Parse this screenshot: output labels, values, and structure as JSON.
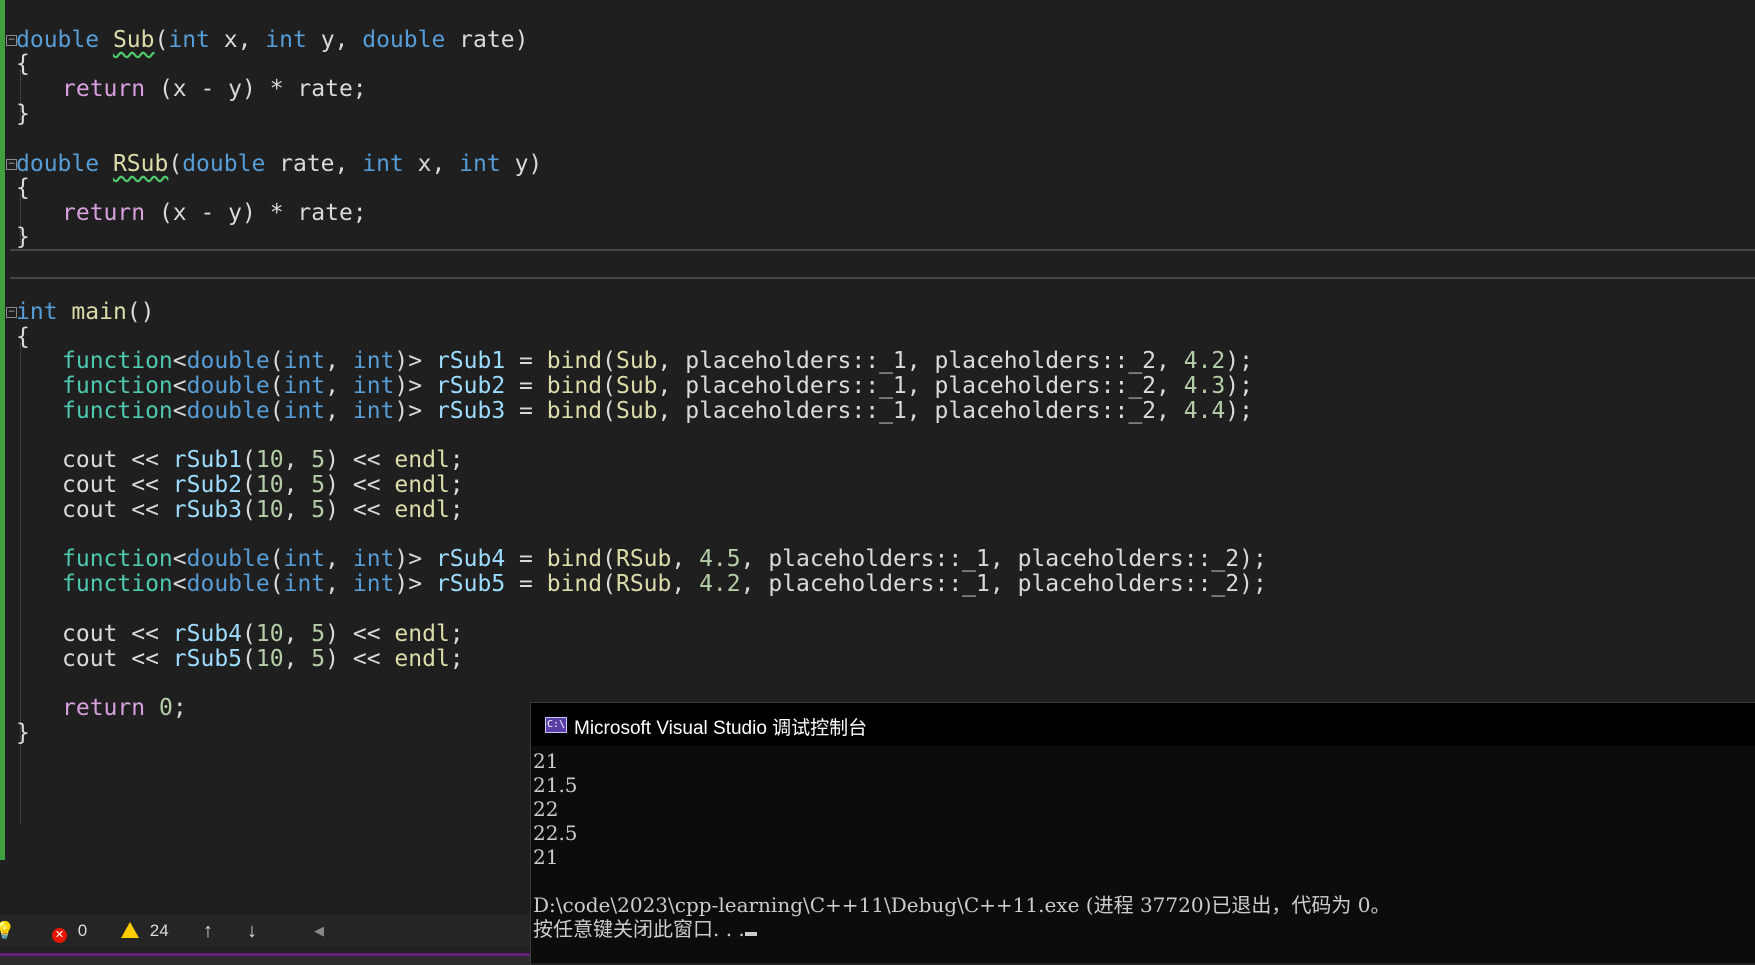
{
  "code": {
    "sub_sig": {
      "ret": "double",
      "name": "Sub",
      "open": "(",
      "t1": "int",
      "p1": " x, ",
      "t2": "int",
      "p2": " y, ",
      "t3": "double",
      "p3": " rate)"
    },
    "brace_open": "{",
    "brace_close": "}",
    "ret_kw": "return",
    "ret_expr": " (x - y) * rate;",
    "rsub_sig": {
      "ret": "double",
      "name": "RSub",
      "open": "(",
      "t1": "double",
      "p1": " rate, ",
      "t2": "int",
      "p2": " x, ",
      "t3": "int",
      "p3": " y)"
    },
    "main_sig": {
      "ret": "int",
      "name": "main",
      "rest": "()"
    },
    "fn_decls": [
      {
        "type": "function",
        "lt": "<",
        "d": "double",
        "op": "(",
        "a": "int",
        "c": ", ",
        "b": "int",
        "gt": ")> ",
        "var": "rSub1",
        "eq": " = ",
        "bind": "bind",
        "open": "(",
        "target": "Sub",
        "mid": ", placeholders::_1, placeholders::_2, ",
        "num": "4.2",
        "end": ");"
      },
      {
        "type": "function",
        "lt": "<",
        "d": "double",
        "op": "(",
        "a": "int",
        "c": ", ",
        "b": "int",
        "gt": ")> ",
        "var": "rSub2",
        "eq": " = ",
        "bind": "bind",
        "open": "(",
        "target": "Sub",
        "mid": ", placeholders::_1, placeholders::_2, ",
        "num": "4.3",
        "end": ");"
      },
      {
        "type": "function",
        "lt": "<",
        "d": "double",
        "op": "(",
        "a": "int",
        "c": ", ",
        "b": "int",
        "gt": ")> ",
        "var": "rSub3",
        "eq": " = ",
        "bind": "bind",
        "open": "(",
        "target": "Sub",
        "mid": ", placeholders::_1, placeholders::_2, ",
        "num": "4.4",
        "end": ");"
      }
    ],
    "cout_lines_1": [
      {
        "cout": "cout",
        "op": " << ",
        "call": "rSub1",
        "open": "(",
        "n1": "10",
        "c": ", ",
        "n2": "5",
        "close": ")",
        "op2": " << ",
        "endl": "endl",
        "end": ";"
      },
      {
        "cout": "cout",
        "op": " << ",
        "call": "rSub2",
        "open": "(",
        "n1": "10",
        "c": ", ",
        "n2": "5",
        "close": ")",
        "op2": " << ",
        "endl": "endl",
        "end": ";"
      },
      {
        "cout": "cout",
        "op": " << ",
        "call": "rSub3",
        "open": "(",
        "n1": "10",
        "c": ", ",
        "n2": "5",
        "close": ")",
        "op2": " << ",
        "endl": "endl",
        "end": ";"
      }
    ],
    "fn_decls_2": [
      {
        "type": "function",
        "lt": "<",
        "d": "double",
        "op": "(",
        "a": "int",
        "c": ", ",
        "b": "int",
        "gt": ")> ",
        "var": "rSub4",
        "eq": " = ",
        "bind": "bind",
        "open": "(",
        "target": "RSub",
        "c2": ", ",
        "num": "4.5",
        "mid": ", placeholders::_1, placeholders::_2);"
      },
      {
        "type": "function",
        "lt": "<",
        "d": "double",
        "op": "(",
        "a": "int",
        "c": ", ",
        "b": "int",
        "gt": ")> ",
        "var": "rSub5",
        "eq": " = ",
        "bind": "bind",
        "open": "(",
        "target": "RSub",
        "c2": ", ",
        "num": "4.2",
        "mid": ", placeholders::_1, placeholders::_2);"
      }
    ],
    "cout_lines_2": [
      {
        "cout": "cout",
        "op": " << ",
        "call": "rSub4",
        "open": "(",
        "n1": "10",
        "c": ", ",
        "n2": "5",
        "close": ")",
        "op2": " << ",
        "endl": "endl",
        "end": ";"
      },
      {
        "cout": "cout",
        "op": " << ",
        "call": "rSub5",
        "open": "(",
        "n1": "10",
        "c": ", ",
        "n2": "5",
        "close": ")",
        "op2": " << ",
        "endl": "endl",
        "end": ";"
      }
    ],
    "main_return": {
      "kw": "return",
      "sp": " ",
      "num": "0",
      "end": ";"
    }
  },
  "statusbar": {
    "errors_icon": "error-icon",
    "errors_count": "0",
    "warnings_icon": "warning-icon",
    "warnings_count": "24",
    "up_arrow": "↑",
    "down_arrow": "↓",
    "scroll_left": "◀"
  },
  "console": {
    "title": "Microsoft Visual Studio 调试控制台",
    "icon_text": "C:\\",
    "output": [
      "21",
      "21.5",
      "22",
      "22.5",
      "21"
    ],
    "exit_message": "D:\\code\\2023\\cpp-learning\\C++11\\Debug\\C++11.exe (进程 37720)已退出，代码为 0。",
    "prompt": "按任意键关闭此窗口. . ."
  },
  "colors": {
    "keyword": "#569cd6",
    "control": "#d8a0df",
    "function": "#dcdcaa",
    "type": "#4ec9b0",
    "variable": "#9cdcfe",
    "number": "#b5cea8",
    "change_bar": "#3fa03f"
  }
}
